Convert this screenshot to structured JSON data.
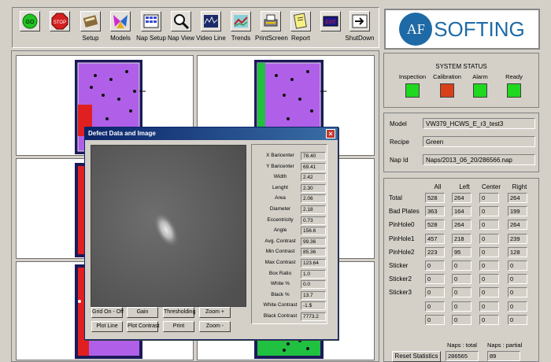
{
  "toolbar": {
    "buttons": [
      {
        "label": "",
        "icon": "go-icon"
      },
      {
        "label": "",
        "icon": "stop-icon"
      },
      {
        "label": "Setup",
        "icon": "setup-icon"
      },
      {
        "label": "Models",
        "icon": "models-icon"
      },
      {
        "label": "Nap Setup",
        "icon": "nap-setup-icon"
      },
      {
        "label": "Nap View",
        "icon": "nap-view-icon"
      },
      {
        "label": "Video Line",
        "icon": "video-line-icon"
      },
      {
        "label": "Trends",
        "icon": "trends-icon"
      },
      {
        "label": "PrintScreen",
        "icon": "printscreen-icon"
      },
      {
        "label": "Report",
        "icon": "report-icon"
      },
      {
        "label": "",
        "icon": "exit-icon"
      },
      {
        "label": "ShutDown",
        "icon": "shutdown-icon"
      }
    ],
    "go_text": "GO",
    "stop_text": "STOP",
    "exit_text": "EXIT"
  },
  "logo": {
    "mark": "AF",
    "word": "SOFTING"
  },
  "system_status": {
    "title": "SYSTEM STATUS",
    "indicators": [
      {
        "label": "Inspection",
        "color": "#1fd81f"
      },
      {
        "label": "Calibration",
        "color": "#d8401a"
      },
      {
        "label": "Alarm",
        "color": "#1fd81f"
      },
      {
        "label": "Ready",
        "color": "#1fd81f"
      }
    ]
  },
  "info": {
    "model_label": "Model",
    "model": "VW379_HCWS_E_r3_test3",
    "recipe_label": "Recipe",
    "recipe": "Green",
    "napid_label": "Nap Id",
    "napid": "Naps/2013_06_20/286566.nap"
  },
  "stats": {
    "columns": [
      "All",
      "Left",
      "Center",
      "Right"
    ],
    "rows": [
      {
        "label": "Total",
        "values": [
          "528",
          "264",
          "0",
          "264"
        ]
      },
      {
        "label": "Bad Plates",
        "values": [
          "363",
          "164",
          "0",
          "199"
        ]
      },
      {
        "label": "PinHole0",
        "values": [
          "528",
          "264",
          "0",
          "264"
        ]
      },
      {
        "label": "PinHole1",
        "values": [
          "457",
          "218",
          "0",
          "239"
        ]
      },
      {
        "label": "PinHole2",
        "values": [
          "223",
          "95",
          "0",
          "128"
        ]
      },
      {
        "label": "Sticker",
        "values": [
          "0",
          "0",
          "0",
          "0"
        ]
      },
      {
        "label": "Sticker2",
        "values": [
          "0",
          "0",
          "0",
          "0"
        ]
      },
      {
        "label": "Sticker3",
        "values": [
          "0",
          "0",
          "0",
          "0"
        ]
      },
      {
        "label": "",
        "values": [
          "0",
          "0",
          "0",
          "0"
        ]
      },
      {
        "label": "",
        "values": [
          "0",
          "0",
          "0",
          "0"
        ]
      }
    ],
    "reset_label": "Reset Statistics",
    "naps_total_label": "Naps : total",
    "naps_total": "286565",
    "naps_partial_label": "Naps : partial",
    "naps_partial": "89"
  },
  "dialog": {
    "title": "Defect Data and Image",
    "buttons_row1": [
      "Grid On - Off",
      "Gain",
      "Thresholding",
      "Zoom +"
    ],
    "buttons_row2": [
      "Plot Line",
      "Plot Contrast",
      "Print",
      "Zoom -"
    ],
    "measurements": [
      {
        "label": "X Baricenter",
        "value": "78.40"
      },
      {
        "label": "Y Baricenter",
        "value": "69.41"
      },
      {
        "label": "Width",
        "value": "2.42"
      },
      {
        "label": "Lenght",
        "value": "2.30"
      },
      {
        "label": "Area",
        "value": "2.06"
      },
      {
        "label": "Diameter",
        "value": "2.18"
      },
      {
        "label": "Eccentricity",
        "value": "0.73"
      },
      {
        "label": "Angle",
        "value": "156.6"
      },
      {
        "label": "Avg. Contrast",
        "value": "99.36"
      },
      {
        "label": "Min Contrast",
        "value": "85.36"
      },
      {
        "label": "Max Contrast",
        "value": "123.64"
      },
      {
        "label": "Box Ratio",
        "value": "1.0"
      },
      {
        "label": "White %",
        "value": "0.0"
      },
      {
        "label": "Black %",
        "value": "13.7"
      },
      {
        "label": "White Contrast",
        "value": "-1.$"
      },
      {
        "label": "Black Contrast",
        "value": "7773.2"
      }
    ]
  }
}
